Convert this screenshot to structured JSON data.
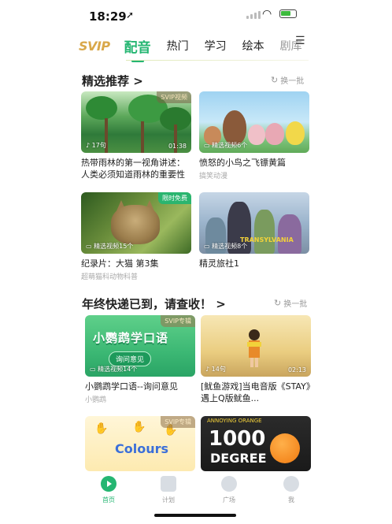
{
  "status_bar": {
    "time": "18:29",
    "location_icon": "location-arrow-icon",
    "wifi_icon": "wifi-icon",
    "battery_icon": "battery-charging-icon"
  },
  "tabs": {
    "svip": "SVIP",
    "items": [
      "配音",
      "热门",
      "学习",
      "绘本",
      "剧库"
    ],
    "active_index": 0,
    "menu_icon": "menu-icon"
  },
  "section1": {
    "title": "精选推荐",
    "title_arrow": ">",
    "refresh_label": "换一批",
    "cards": [
      {
        "title": "热带雨林的第一视角讲述：人类必须知道雨林的重要性",
        "subtitle": "",
        "badge": "SVIP视频",
        "left": "17句",
        "right": "01:38"
      },
      {
        "title": "愤怒的小鸟之飞镖黄篇",
        "subtitle": "搞笑动漫",
        "badge": "",
        "left": "精选视频6个",
        "right": ""
      },
      {
        "title": "纪录片：大猫 第3集",
        "subtitle": "超萌猫科动物科普",
        "badge": "限时免费",
        "left": "精选视频15个",
        "right": ""
      },
      {
        "title": "精灵旅社1",
        "subtitle": "",
        "badge": "",
        "left": "精选视频8个",
        "right": "",
        "poster_text": "TRANSYLVANIA"
      }
    ]
  },
  "section2": {
    "title": "年终快递已到，请查收！",
    "title_arrow": ">",
    "refresh_label": "换一批",
    "cards": [
      {
        "title": "小鹦鹉学口语--询问意见",
        "subtitle": "小鹦鹉",
        "badge": "SVIP专辑",
        "left": "精选视频14个",
        "right": "",
        "banner": "小鹦鹉学口语",
        "button": "询问意见"
      },
      {
        "title": "[鱿鱼游戏]当电音版《STAY》遇上Q版鱿鱼...",
        "subtitle": "",
        "badge": "",
        "left": "14句",
        "right": "02:13"
      },
      {
        "title": "",
        "subtitle": "",
        "badge": "SVIP专辑",
        "left": "",
        "right": "",
        "poster_text": "Colours"
      },
      {
        "title": "",
        "subtitle": "",
        "badge": "",
        "left": "",
        "right": "",
        "poster_big": "1000",
        "poster_small": "DEGREE",
        "poster_logo": "ANNOYING ORANGE"
      }
    ]
  },
  "bottom_nav": [
    {
      "label": "首页",
      "icon": "home-play-icon",
      "active": true
    },
    {
      "label": "计划",
      "icon": "plan-book-icon",
      "active": false
    },
    {
      "label": "广场",
      "icon": "square-icon",
      "active": false
    },
    {
      "label": "我",
      "icon": "profile-icon",
      "active": false
    }
  ],
  "colors": {
    "accent": "#25b672",
    "svip_gold": "#d9a84a"
  }
}
